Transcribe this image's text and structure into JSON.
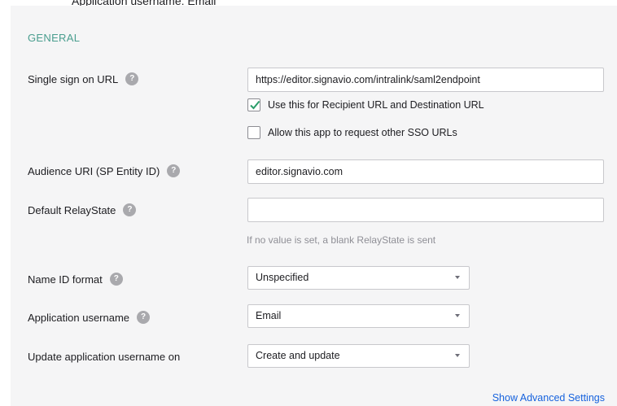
{
  "caption": "Application username: Email",
  "section": {
    "title": "GENERAL"
  },
  "fields": {
    "sso_url": {
      "label": "Single sign on URL",
      "value": "https://editor.signavio.com/intralink/saml2endpoint"
    },
    "recipient_checkbox": {
      "label": "Use this for Recipient URL and Destination URL",
      "checked": true
    },
    "other_sso_checkbox": {
      "label": "Allow this app to request other SSO URLs",
      "checked": false
    },
    "audience_uri": {
      "label": "Audience URI (SP Entity ID)",
      "value": "editor.signavio.com"
    },
    "relay_state": {
      "label": "Default RelayState",
      "value": "",
      "hint": "If no value is set, a blank RelayState is sent"
    },
    "name_id_format": {
      "label": "Name ID format",
      "selected": "Unspecified"
    },
    "app_username": {
      "label": "Application username",
      "selected": "Email"
    },
    "update_username_on": {
      "label": "Update application username on",
      "selected": "Create and update"
    }
  },
  "help_glyph": "?",
  "links": {
    "advanced": "Show Advanced Settings"
  },
  "colors": {
    "section_title": "#4a9e8f",
    "checkmark": "#2a9d69",
    "link": "#1662dd",
    "help_icon": "#a9a9ad"
  }
}
